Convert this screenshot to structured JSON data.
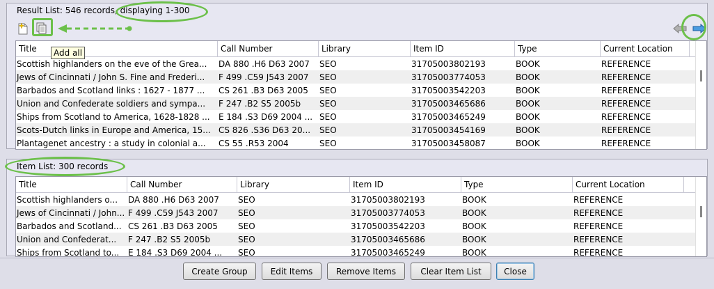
{
  "result_panel": {
    "title": "Result List: 546 records, displaying 1-300",
    "tooltip": "Add all",
    "columns": [
      "Title",
      "Call Number",
      "Library",
      "Item ID",
      "Type",
      "Current Location"
    ],
    "rows": [
      [
        "Scottish highlanders on the eve of the Grea...",
        "DA 880 .H6 D63 2007",
        "SEO",
        "31705003802193",
        "BOOK",
        "REFERENCE"
      ],
      [
        "Jews of Cincinnati / John S. Fine and Frederi...",
        "F 499 .C59 J543 2007",
        "SEO",
        "31705003774053",
        "BOOK",
        "REFERENCE"
      ],
      [
        "Barbados and Scotland links : 1627 - 1877 ...",
        "CS 261 .B3 D63 2005",
        "SEO",
        "31705003542203",
        "BOOK",
        "REFERENCE"
      ],
      [
        "Union and Confederate soldiers and sympa...",
        "F 247 .B2 S5 2005b",
        "SEO",
        "31705003465686",
        "BOOK",
        "REFERENCE"
      ],
      [
        "Ships from Scotland to America, 1628-1828 ...",
        "E 184 .S3 D69 2004 ...",
        "SEO",
        "31705003465249",
        "BOOK",
        "REFERENCE"
      ],
      [
        "Scots-Dutch links in Europe and America, 15...",
        "CS 826 .S36 D63 20...",
        "SEO",
        "31705003454169",
        "BOOK",
        "REFERENCE"
      ],
      [
        "Plantagenet ancestry : a study in colonial a...",
        "CS 55 .R53 2004",
        "SEO",
        "31705003458087",
        "BOOK",
        "REFERENCE"
      ]
    ]
  },
  "item_panel": {
    "title": "Item List: 300 records",
    "columns": [
      "Title",
      "Call Number",
      "Library",
      "Item ID",
      "Type",
      "Current Location"
    ],
    "rows": [
      [
        "Scottish highlanders o...",
        "DA 880 .H6 D63 2007",
        "SEO",
        "31705003802193",
        "BOOK",
        "REFERENCE"
      ],
      [
        "Jews of Cincinnati / John...",
        "F 499 .C59 J543 2007",
        "SEO",
        "31705003774053",
        "BOOK",
        "REFERENCE"
      ],
      [
        "Barbados and Scotland...",
        "CS 261 .B3 D63 2005",
        "SEO",
        "31705003542203",
        "BOOK",
        "REFERENCE"
      ],
      [
        "Union and Confederat...",
        "F 247 .B2 S5 2005b",
        "SEO",
        "31705003465686",
        "BOOK",
        "REFERENCE"
      ],
      [
        "Ships from Scotland to...",
        "E 184 .S3 D69 2004 ...",
        "SEO",
        "31705003465249",
        "BOOK",
        "REFERENCE"
      ]
    ]
  },
  "buttons": {
    "create_group": "Create Group",
    "edit_items": "Edit Items",
    "remove_items": "Remove Items",
    "clear_item_list": "Clear Item List",
    "close": "Close"
  },
  "icons": {
    "add_selected": "add-selected-icon",
    "add_all": "add-all-icon",
    "previous": "arrow-left-icon",
    "next": "arrow-right-icon"
  },
  "colors": {
    "annotation": "#6cc04a",
    "next_arrow": "#4a9be0"
  }
}
